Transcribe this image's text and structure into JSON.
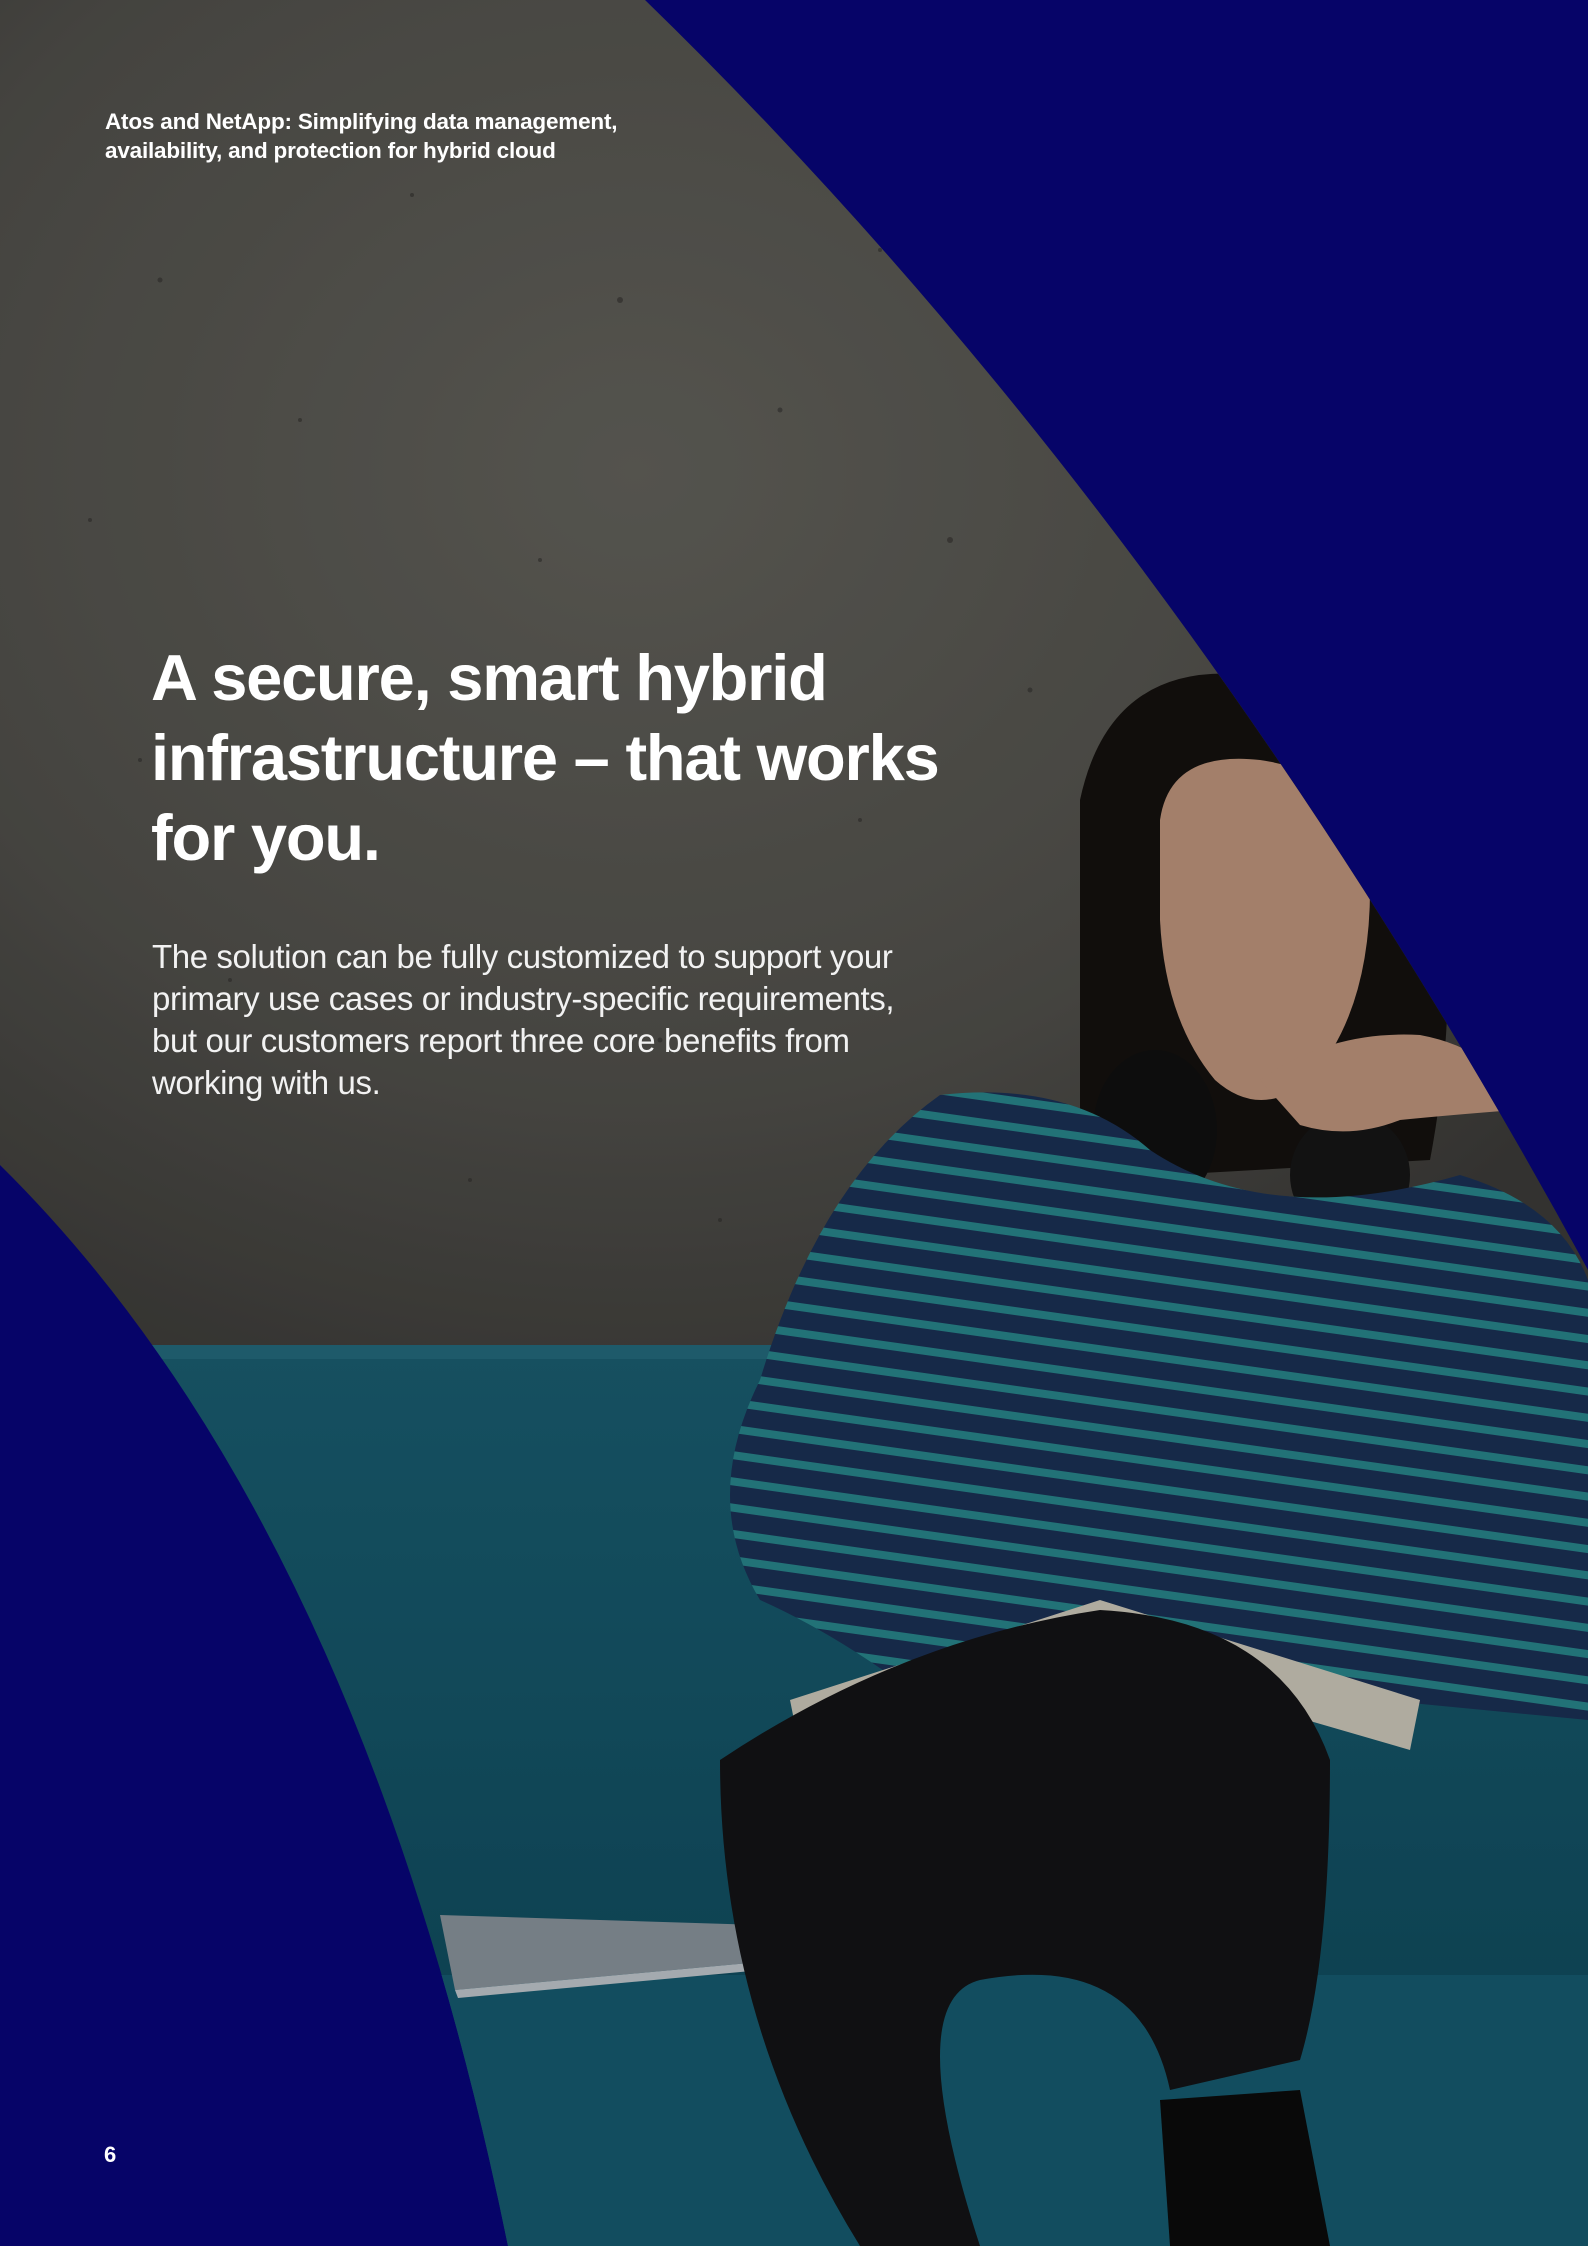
{
  "document": {
    "header_lines": [
      "Atos and NetApp:  Simplifying data management,",
      "availability, and protection for hybrid cloud"
    ],
    "headline_lines": [
      "A secure, smart hybrid",
      "infrastructure – that works",
      "for you."
    ],
    "body_lines": [
      "The solution can be fully customized to support your",
      "primary use cases or industry-specific requirements,",
      "but our customers report three core benefits from",
      "working with us."
    ],
    "page_number": "6"
  },
  "colors": {
    "brand_navy": "#060468",
    "wall_gray": "#5c5b57",
    "sofa_teal": "#14586c",
    "text_white": "#ffffff"
  }
}
